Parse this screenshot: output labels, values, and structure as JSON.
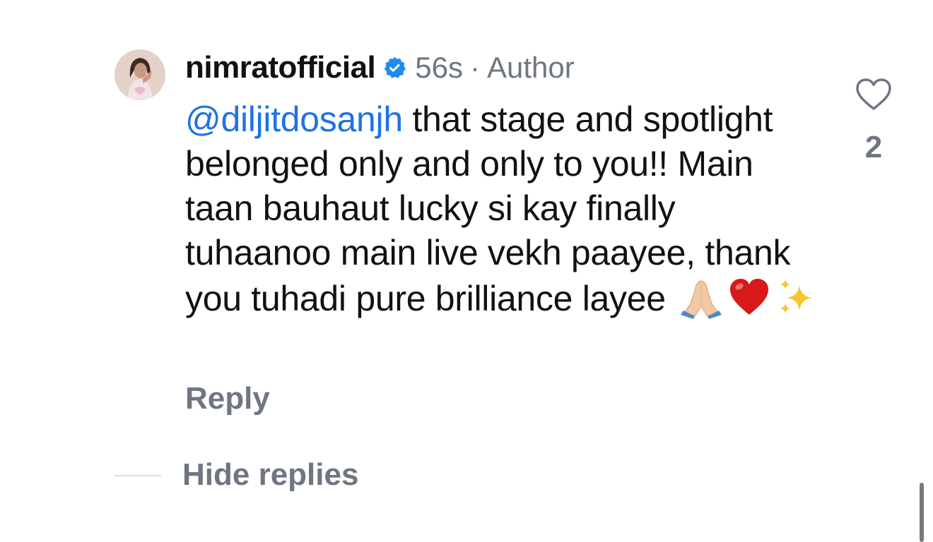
{
  "comment": {
    "username": "nimratofficial",
    "timestamp": "56s",
    "separator": "·",
    "role_label": "Author",
    "mention": "@diljitdosanjh",
    "text": " that stage and spotlight belonged only and only to you!! Main taan bauhaut lucky si kay finally tuhaanoo main live vekh paayee, thank you tuhadi pure brilliance layee",
    "emojis": [
      "folded-hands",
      "red-heart",
      "sparkles"
    ],
    "reply_label": "Reply",
    "likes": "2"
  },
  "replies": {
    "hide_label": "Hide replies"
  },
  "colors": {
    "mention": "#1d72e8",
    "verified_badge": "#1d8cf0",
    "meta_text": "#6f7681",
    "heart_emoji": "#d8191a",
    "scrollbar": "#7a7a7a"
  },
  "icons": {
    "like": "heart-outline-icon",
    "verified": "verified-badge-icon"
  }
}
